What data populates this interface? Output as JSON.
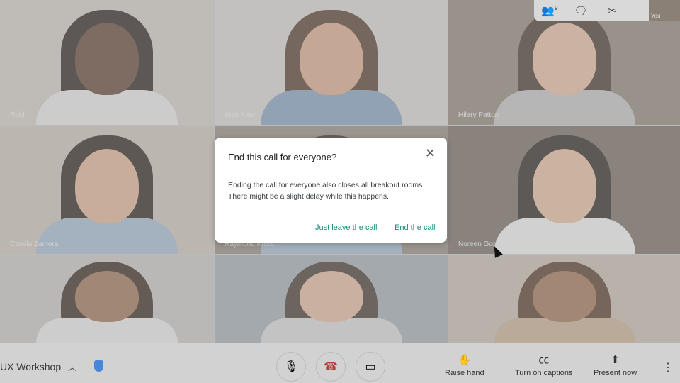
{
  "participants": [
    {
      "name": "Reid",
      "bg": "#cfcac4",
      "skin": "#5a3a28",
      "shirt": "#e8e8e8",
      "hair": "#1e1410"
    },
    {
      "name": "Alan Kaur",
      "bg": "#d6d3cf",
      "skin": "#d9a582",
      "shirt": "#7e9bbd",
      "hair": "#4a3020"
    },
    {
      "name": "Hilary Patton",
      "bg": "#8a7e72",
      "skin": "#e8b99c",
      "shirt": "#bfbfbf",
      "hair": "#3d2a1f"
    },
    {
      "name": "Camila Zamora",
      "bg": "#c9bfb3",
      "skin": "#e0b08e",
      "shirt": "#9fb7cf",
      "hair": "#1f1510"
    },
    {
      "name": "Raymond Knox",
      "bg": "#8f8478",
      "skin": "#b88a6a",
      "shirt": "#9eb5cc",
      "hair": "#2a1f18"
    },
    {
      "name": "Noreen Gomez",
      "bg": "#6e6258",
      "skin": "#e6b999",
      "shirt": "#f1f1f1",
      "hair": "#1e1612"
    },
    {
      "name": "",
      "bg": "#c6c3c0",
      "skin": "#9a6a4c",
      "shirt": "#e9e9e9",
      "hair": "#2b1a10"
    },
    {
      "name": "",
      "bg": "#9da8ad",
      "skin": "#e2b497",
      "shirt": "#d8d8d8",
      "hair": "#3a2a20"
    },
    {
      "name": "",
      "bg": "#c4b8ac",
      "skin": "#9b6a4a",
      "shirt": "#c6aa8a",
      "hair": "#4a2c18"
    }
  ],
  "topbar": {
    "participant_count": "9",
    "self_label": "You"
  },
  "dialog": {
    "title": "End this call for everyone?",
    "body": "Ending the call for everyone also closes all breakout rooms. There might be a slight delay while this happens.",
    "leave_label": "Just leave the call",
    "end_label": "End the call",
    "accent": "#1a8a7e"
  },
  "bottom": {
    "meeting_name": "UX Workshop",
    "raise_hand": "Raise hand",
    "captions": "Turn on captions",
    "present": "Present now"
  }
}
